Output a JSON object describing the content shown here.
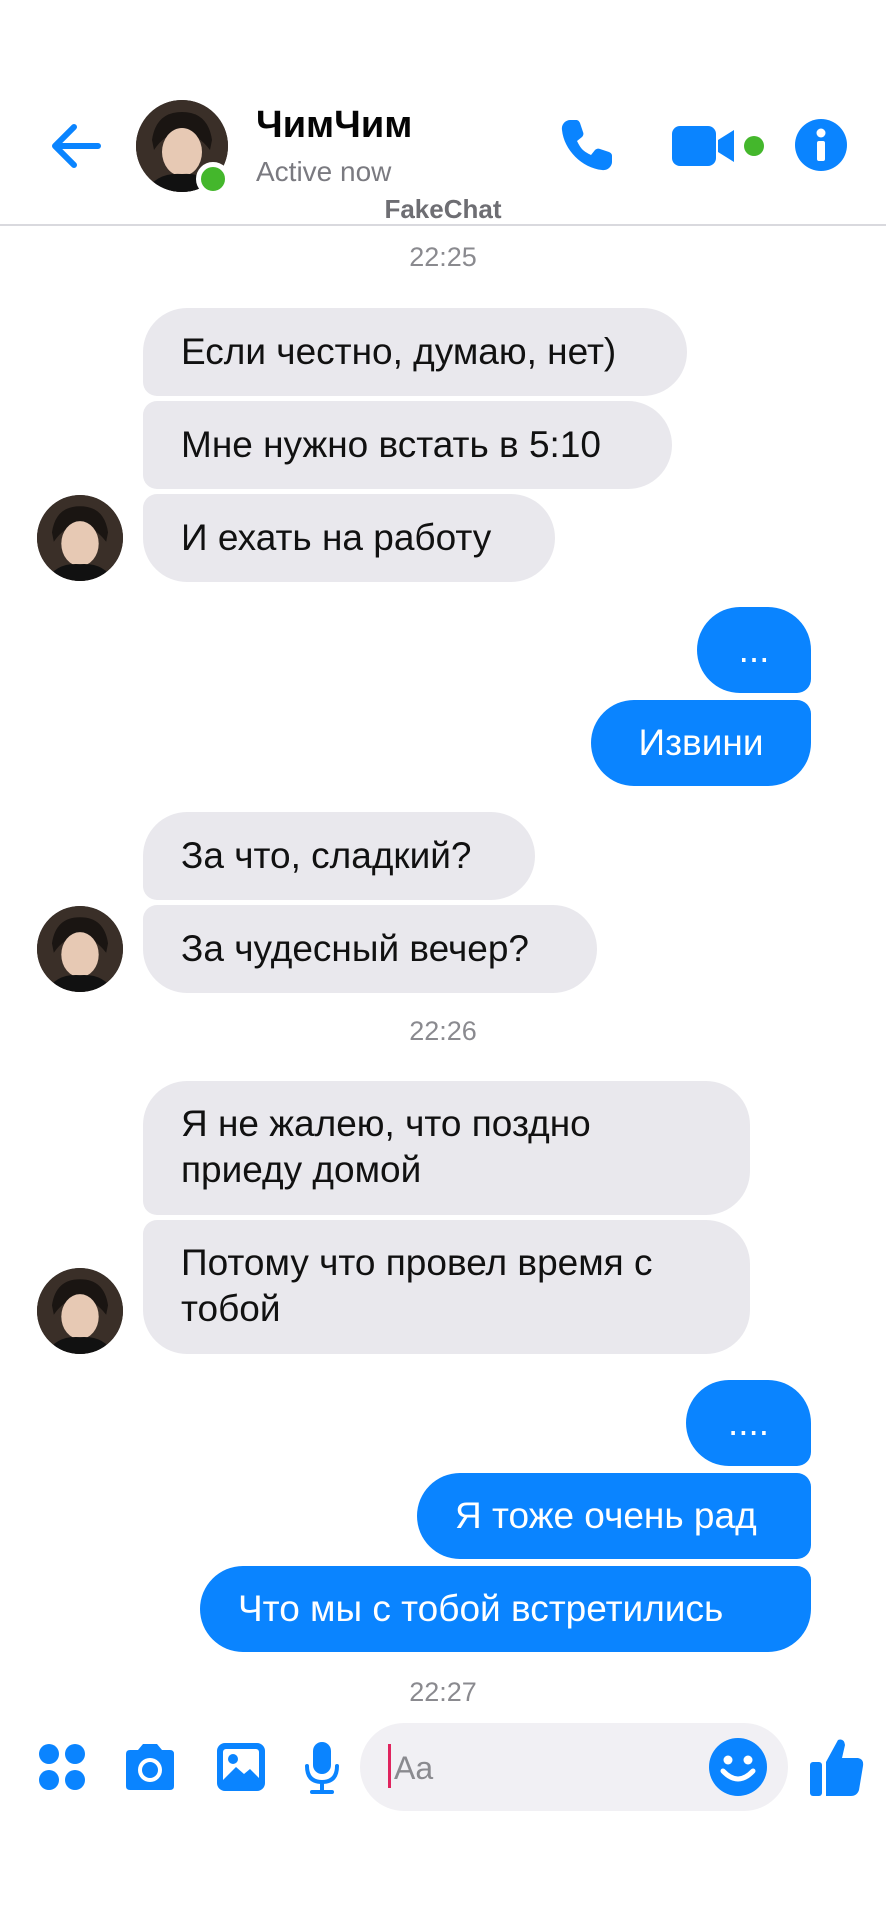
{
  "header": {
    "contact_name": "ЧимЧим",
    "status": "Active now",
    "watermark": "FakeChat",
    "accent_color": "#0a84ff",
    "online_color": "#44b72c",
    "icons": [
      "back-arrow-icon",
      "phone-icon",
      "video-camera-icon",
      "info-icon"
    ]
  },
  "timestamps": [
    "22:25",
    "22:26",
    "22:27"
  ],
  "messages": [
    {
      "side": "in",
      "text": "Если честно, думаю, нет)"
    },
    {
      "side": "in",
      "text": "Мне нужно встать в 5:10"
    },
    {
      "side": "in",
      "text": "И ехать на работу"
    },
    {
      "side": "out",
      "text": "..."
    },
    {
      "side": "out",
      "text": "Извини"
    },
    {
      "side": "in",
      "text": "За что, сладкий?"
    },
    {
      "side": "in",
      "text": "За чудесный вечер?"
    },
    {
      "side": "in",
      "lines": [
        "Я не жалею, что поздно",
        "приеду домой"
      ]
    },
    {
      "side": "in",
      "lines": [
        "Потому что провел время с",
        "тобой"
      ]
    },
    {
      "side": "out",
      "text": "...."
    },
    {
      "side": "out",
      "text": "Я тоже очень рад"
    },
    {
      "side": "out",
      "text": "Что мы с тобой встретились"
    }
  ],
  "composer": {
    "placeholder": "Aa",
    "icons": [
      "apps-grid-icon",
      "camera-icon",
      "image-icon",
      "microphone-icon",
      "emoji-icon",
      "thumbs-up-icon"
    ]
  }
}
